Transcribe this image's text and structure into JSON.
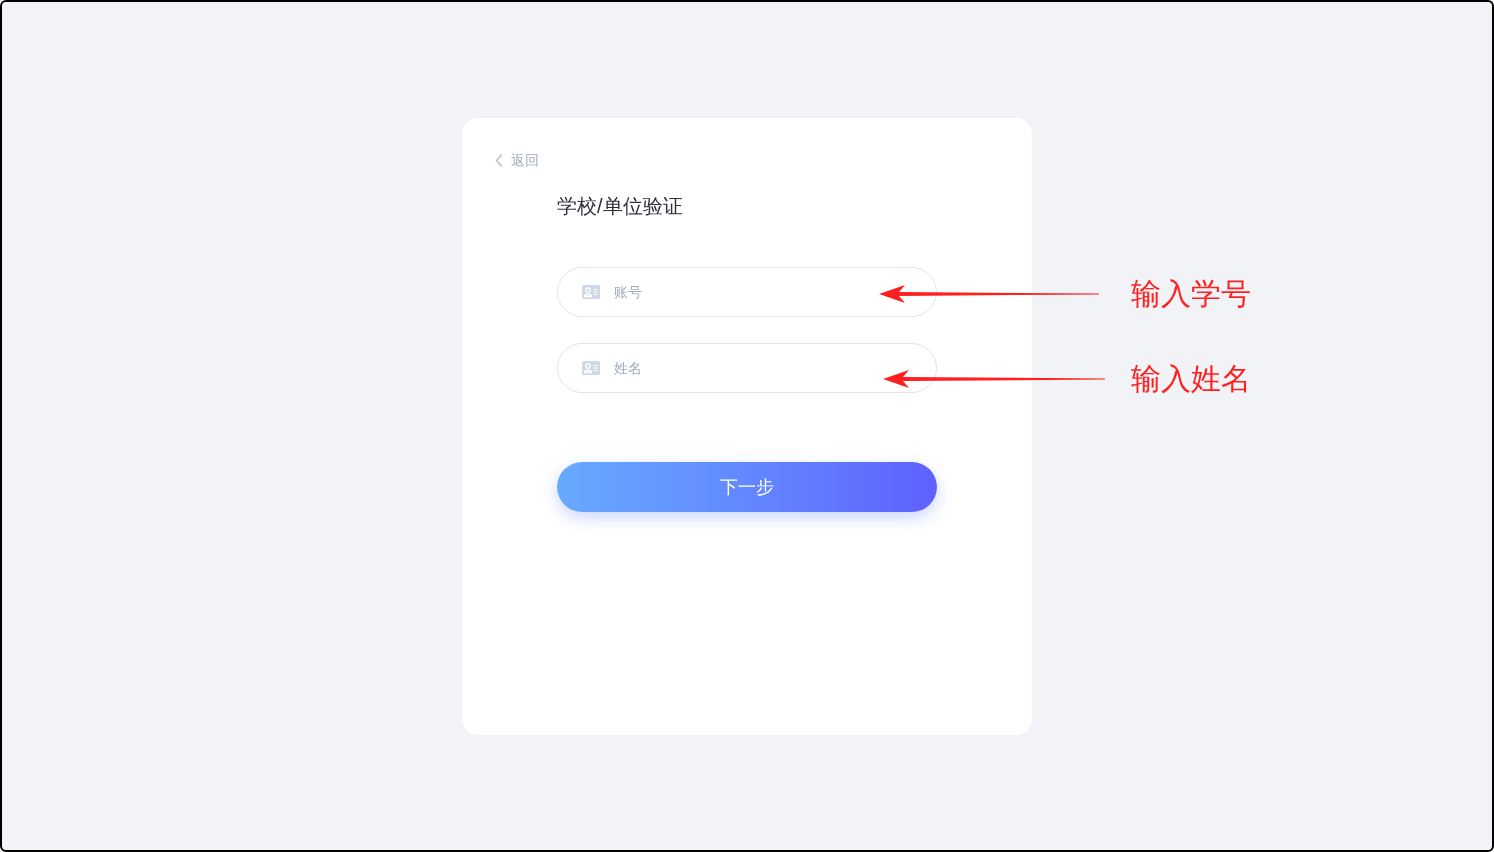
{
  "back_link": {
    "label": "返回"
  },
  "title": "学校/单位验证",
  "form": {
    "fields": [
      {
        "placeholder": "账号"
      },
      {
        "placeholder": "姓名"
      }
    ],
    "submit": {
      "label": "下一步"
    }
  },
  "annotations": [
    {
      "text": "输入学号"
    },
    {
      "text": "输入姓名"
    }
  ]
}
